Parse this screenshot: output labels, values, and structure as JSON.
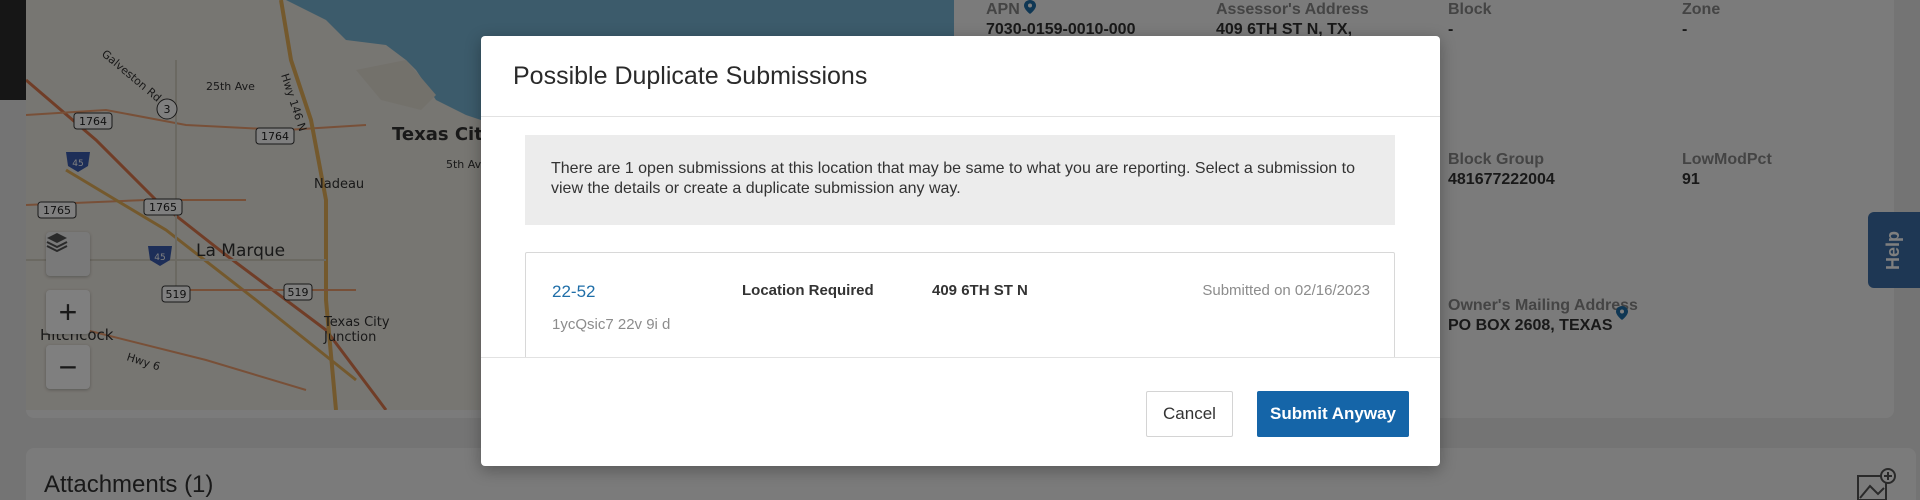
{
  "map": {
    "labels": {
      "city1": "Texas City",
      "city2": "La Marque",
      "city3": "Nadeau",
      "city4": "Hitchcock",
      "city5": "Texas City\nJunction",
      "road1": "Galveston Rd",
      "road2": "25th Ave",
      "road3": "Hwy 146 N",
      "road4": "Hwy 6",
      "road5": "5th Av",
      "shield1764a": "1764",
      "shield1764b": "1764",
      "shield1765a": "1765",
      "shield1765b": "1765",
      "shield519a": "519",
      "shield519b": "519",
      "shield3": "3",
      "shield45a": "45",
      "shield45b": "45"
    },
    "controls": {
      "zoom_in": "+",
      "zoom_out": "−"
    }
  },
  "details": {
    "apn_label": "APN",
    "apn_value": "7030-0159-0010-000",
    "assessor_label": "Assessor's Address",
    "assessor_value": "409 6TH ST N, TX,",
    "block_label": "Block",
    "block_value": "-",
    "zone_label": "Zone",
    "zone_value": "-",
    "block_group_label": "Block Group",
    "block_group_value": "481677222004",
    "lowmod_label": "LowModPct",
    "lowmod_value": "91",
    "owner_mailing_label": "Owner's Mailing Address",
    "owner_mailing_value": "PO BOX 2608, TEXAS"
  },
  "attachments": {
    "title": "Attachments (1)"
  },
  "help": {
    "label": "Help"
  },
  "modal": {
    "title": "Possible Duplicate Submissions",
    "notice": "There are 1 open submissions at this location that may be same to what you are reporting. Select a submission to view the details or create a duplicate submission any way.",
    "submission": {
      "id": "22-52",
      "code": "1ycQsic7 22v 9i d",
      "type": "Location Required",
      "address": "409 6TH ST N",
      "date": "Submitted on 02/16/2023"
    },
    "cancel_label": "Cancel",
    "submit_label": "Submit Anyway"
  }
}
